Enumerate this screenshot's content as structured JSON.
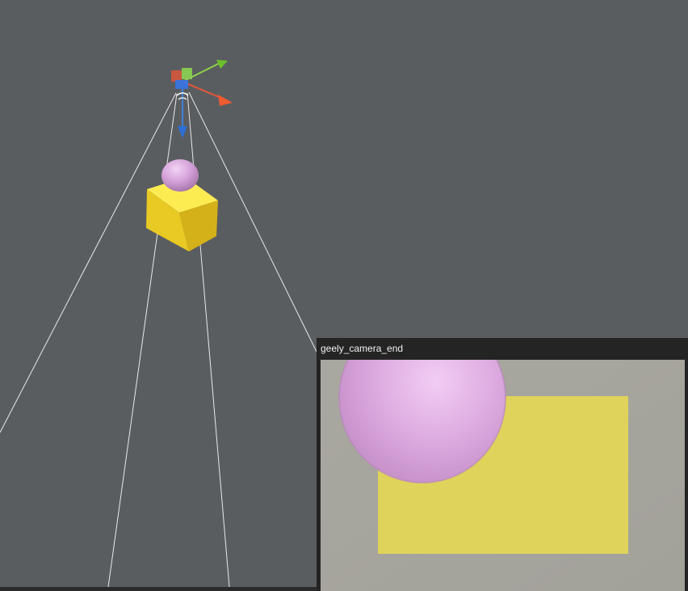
{
  "scene": {
    "background_color": "#5a5d60",
    "objects": [
      {
        "name": "camera",
        "gizmo": "transform-gizmo"
      },
      {
        "name": "sphere",
        "color": "#d9a6dd"
      },
      {
        "name": "box",
        "color": "#f1d532"
      }
    ]
  },
  "camera_preview": {
    "title": "geely_camera_end",
    "background_color": "#a6a59d",
    "colors": {
      "box": "#dfd35c",
      "sphere": "#e2b0e6"
    }
  }
}
